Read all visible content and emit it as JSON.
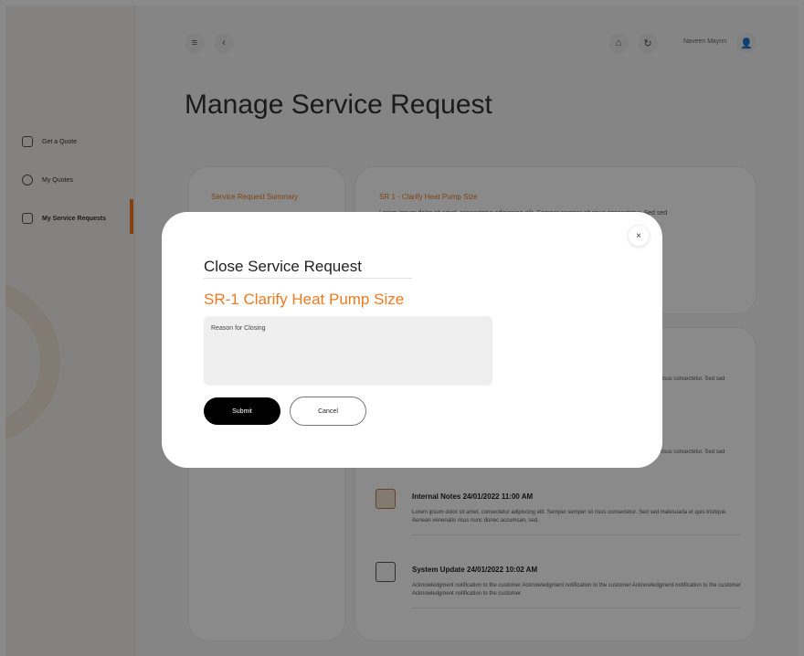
{
  "sidebar": {
    "items": [
      {
        "label": "Get a Quote",
        "icon": "quote-icon"
      },
      {
        "label": "My Quotes",
        "icon": "info-icon"
      },
      {
        "label": "My Service Requests",
        "icon": "service-icon"
      }
    ]
  },
  "header": {
    "menu_icon": "≡",
    "back_icon": "‹",
    "home_icon": "⌂",
    "refresh_icon": "↻",
    "user_name": "Naveen Maynn",
    "user_icon": "👤"
  },
  "page": {
    "title": "Manage Service Request"
  },
  "summary_card": {
    "link": "Service Request Summary"
  },
  "request_card": {
    "title": "SR 1 - Clarify Heat Pump Size",
    "text": "Lorem ipsum dolor sit amet, consectetur adipiscing elit. Semper semper sit risus consectetur. Sed sed"
  },
  "updates": [
    {
      "partial": "risus consectetur. Sed sed"
    },
    {
      "partial": "risus consectetur. Sed sed"
    },
    {
      "heading": "Internal Notes  24/01/2022 11:00 AM",
      "text": "Lorem ipsum dolor sit amet, consectetur adipiscing elit. Semper semper sit risus consectetur. Sed sed malesuada et quis tristique. Aenean venenatis risus nunc donec accumsan, sed."
    },
    {
      "heading": "System Update  24/01/2022 10:02 AM",
      "text": "Acknowledgment notification to the customer Acknowledgment notification to the customer Acknowledgment notification to the customer Acknowledgment notification to the customer"
    }
  ],
  "modal": {
    "close_label": "×",
    "title": "Close Service Request",
    "sr_title": "SR-1 Clarify Heat Pump Size",
    "reason_placeholder": "Reason for Closing",
    "reason_value": "",
    "submit_label": "Submit",
    "cancel_label": "Cancel"
  },
  "colors": {
    "accent": "#f07a20",
    "overlay": "rgba(0,0,0,0.46)"
  }
}
